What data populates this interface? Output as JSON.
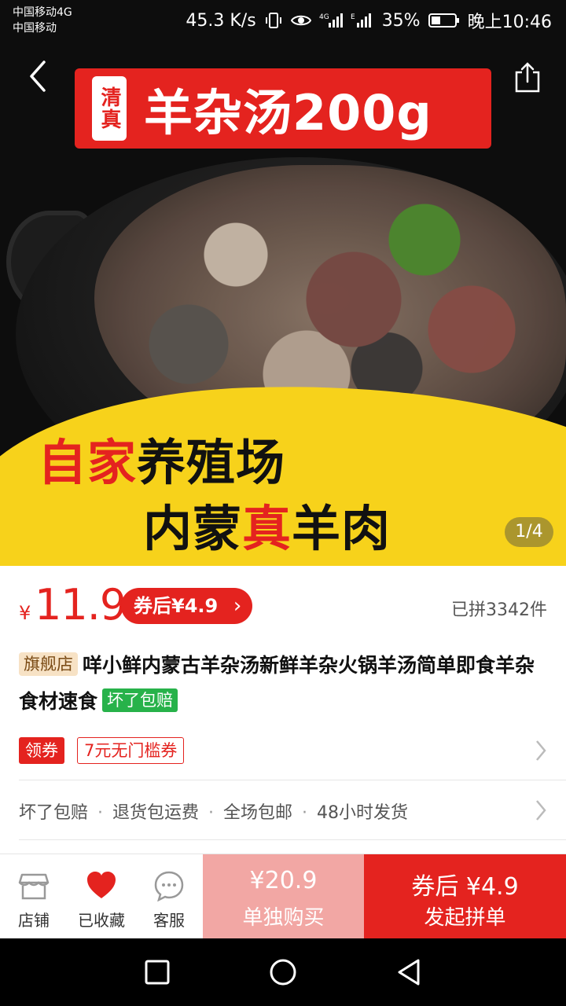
{
  "status_bar": {
    "carrier_line1": "中国移动4G",
    "carrier_line2": "中国移动",
    "speed": "45.3 K/s",
    "battery": "35%",
    "time": "晚上10:46"
  },
  "hero": {
    "badge": "清真",
    "title": "羊杂汤200g",
    "slogan1_red": "自家",
    "slogan1_black": "养殖场",
    "slogan2_black_a": "内蒙",
    "slogan2_red": "真",
    "slogan2_black_b": "羊肉",
    "page_indicator": "1/4"
  },
  "product": {
    "price_symbol": "¥",
    "price": "11.9",
    "coupon_price": "券后¥4.9",
    "coupon_chevron": "›",
    "sold": "已拼3342件",
    "shop_tag": "旗舰店",
    "title": "咩小鲜内蒙古羊杂汤新鲜羊杂火锅羊汤简单即食羊杂食材速食",
    "guarantee_tag": "坏了包赔"
  },
  "coupons": {
    "get_label": "领券",
    "chip": "7元无门槛券"
  },
  "services": [
    "坏了包赔",
    "退货包运费",
    "全场包邮",
    "48小时发货"
  ],
  "service_separator": "·",
  "action_bar": {
    "shop": "店铺",
    "favorite": "已收藏",
    "service": "客服",
    "buy_alone_price": "¥20.9",
    "buy_alone_label": "单独购买",
    "group_price": "券后 ¥4.9",
    "group_label": "发起拼单"
  },
  "colors": {
    "accent": "#e4231f",
    "banner_yellow": "#f7d21b",
    "buy_alone_bg": "#f2a7a4",
    "guarantee_green": "#27b24a"
  },
  "icons": [
    "back-icon",
    "share-icon",
    "store-icon",
    "heart-icon",
    "chat-icon",
    "nav-square-icon",
    "nav-circle-icon",
    "nav-back-icon"
  ]
}
